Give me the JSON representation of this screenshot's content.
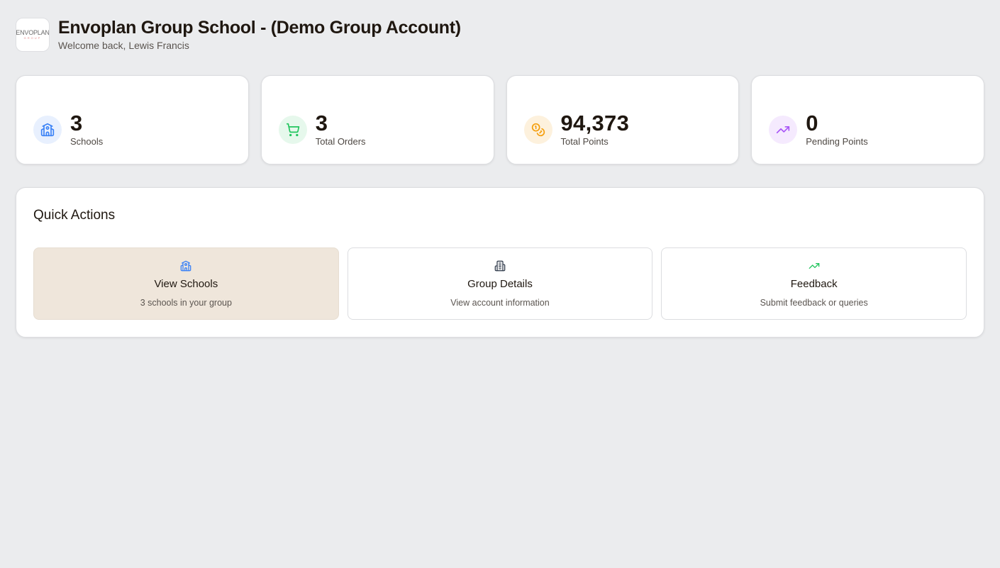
{
  "header": {
    "logo_text": "ENVOPLAN",
    "logo_subtext": "GROUP",
    "title": "Envoplan Group School - (Demo Group Account)",
    "welcome": "Welcome back, Lewis Francis"
  },
  "stats": [
    {
      "icon": "school-icon",
      "value": "3",
      "label": "Schools",
      "color": "#3b82f6",
      "bg": "#e8f0fe"
    },
    {
      "icon": "cart-icon",
      "value": "3",
      "label": "Total Orders",
      "color": "#22c55e",
      "bg": "#e6f8ec"
    },
    {
      "icon": "coins-icon",
      "value": "94,373",
      "label": "Total Points",
      "color": "#f59e0b",
      "bg": "#fdf1dd"
    },
    {
      "icon": "trending-up-icon",
      "value": "0",
      "label": "Pending Points",
      "color": "#a855f7",
      "bg": "#f5eafe"
    }
  ],
  "quick_actions": {
    "title": "Quick Actions",
    "items": [
      {
        "icon": "school-icon",
        "title": "View Schools",
        "subtitle": "3 schools in your group",
        "color": "#3b82f6"
      },
      {
        "icon": "building-icon",
        "title": "Group Details",
        "subtitle": "View account information",
        "color": "#374151"
      },
      {
        "icon": "trending-up-icon",
        "title": "Feedback",
        "subtitle": "Submit feedback or queries",
        "color": "#22c55e"
      }
    ]
  }
}
